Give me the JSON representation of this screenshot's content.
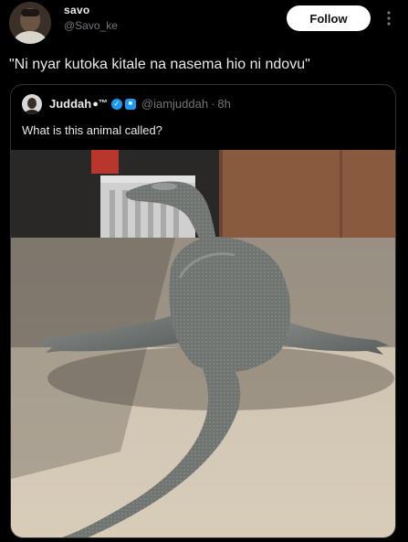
{
  "post": {
    "display_name": "savo",
    "handle": "@Savo_ke",
    "follow_label": "Follow",
    "more_icon": "more-vertical-icon",
    "text": "\"Ni nyar kutoka kitale na nasema hio ni ndovu\""
  },
  "quoted": {
    "display_name": "Juddah",
    "name_suffix": "™",
    "handle": "@iamjuddah",
    "separator": "·",
    "time": "8h",
    "text": "What is this animal called?"
  },
  "colors": {
    "background": "#000000",
    "text": "#e7e9ea",
    "secondary": "#71767b",
    "border": "#2f3336",
    "verified": "#1d9bf0"
  }
}
